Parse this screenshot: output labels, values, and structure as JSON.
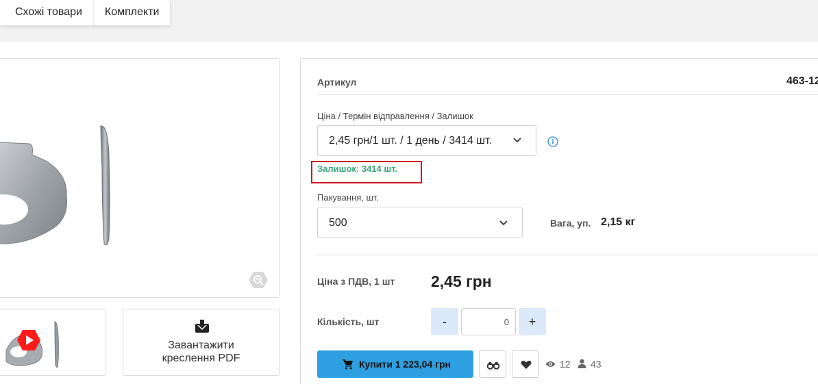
{
  "tabs": [
    {
      "label": "Схожі товари"
    },
    {
      "label": "Комплекти"
    }
  ],
  "download": {
    "label_line1": "Завантажити",
    "label_line2": "креслення PDF"
  },
  "product": {
    "sku_label": "Артикул",
    "sku_value": "463-12",
    "price_select_label": "Ціна / Термін відправлення / Залишок",
    "price_select_value": "2,45 грн/1 шт. / 1 день / 3414 шт.",
    "stock_text": "Залишок: 3414 шт.",
    "packaging_label": "Пакування, шт.",
    "packaging_value": "500",
    "weight_label": "Вага, уп.",
    "weight_value": "2,15 кг",
    "vat_label": "Ціна з ПДВ, 1 шт",
    "price": "2,45 грн",
    "quantity_label": "Кількість, шт",
    "quantity_value": "0",
    "minus_label": "-",
    "plus_label": "+",
    "buy_label": "Купити 1 223,04 грн",
    "views_count": "12",
    "users_count": "43"
  },
  "icons": {
    "zoom": "zoom-hex-icon",
    "video": "youtube-play-icon",
    "download": "download-icon",
    "info": "info-circle-icon",
    "cart": "cart-icon",
    "compare": "binoculars-icon",
    "favorite": "heart-icon",
    "views": "eye-icon",
    "users": "user-icon"
  },
  "colors": {
    "accent_blue": "#2e9fe0",
    "qty_button_bg": "#dce9f9",
    "stock_green": "#3aa576",
    "highlight_red": "#d0161d",
    "info_blue": "#2b8fd6"
  }
}
